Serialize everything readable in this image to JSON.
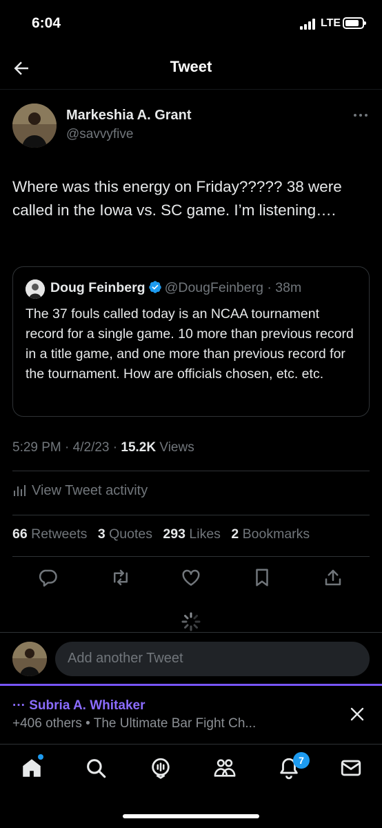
{
  "status_bar": {
    "time": "6:04",
    "network": "LTE"
  },
  "header": {
    "title": "Tweet"
  },
  "tweet": {
    "author_name": "Markeshia A. Grant",
    "author_handle": "@savvyfive",
    "text": "Where was this energy on Friday????? 38 were called in the Iowa vs. SC game. I’m listening….",
    "time": "5:29 PM",
    "date": "4/2/23",
    "views_count": "15.2K",
    "views_label": "Views"
  },
  "quoted_tweet": {
    "author_name": "Doug Feinberg",
    "author_handle": "@DougFeinberg",
    "time": "38m",
    "text": "The 37 fouls called today is an NCAA tournament record for a single game. 10 more than previous record in a title game, and one more than previous record for the tournament. How are officials chosen, etc. etc."
  },
  "activity_label": "View Tweet activity",
  "stats": [
    {
      "count": "66",
      "label": "Retweets"
    },
    {
      "count": "3",
      "label": "Quotes"
    },
    {
      "count": "293",
      "label": "Likes"
    },
    {
      "count": "2",
      "label": "Bookmarks"
    }
  ],
  "compose": {
    "placeholder": "Add another Tweet"
  },
  "space_bar": {
    "host": "··· Subria A. Whitaker",
    "subtitle": "+406 others • The Ultimate Bar Fight Ch..."
  },
  "tabbar": {
    "notification_count": "7"
  },
  "colors": {
    "accent": "#1d9bf0",
    "spaces": "#7856ff",
    "muted": "#71767b",
    "border": "#2f3336"
  },
  "icons": [
    "back-arrow-icon",
    "more-icon",
    "verified-icon",
    "bar-chart-icon",
    "reply-icon",
    "retweet-icon",
    "like-icon",
    "bookmark-icon",
    "share-icon",
    "loading-spinner-icon",
    "close-icon",
    "home-icon",
    "search-icon",
    "spaces-icon",
    "communities-icon",
    "notifications-icon",
    "messages-icon"
  ]
}
